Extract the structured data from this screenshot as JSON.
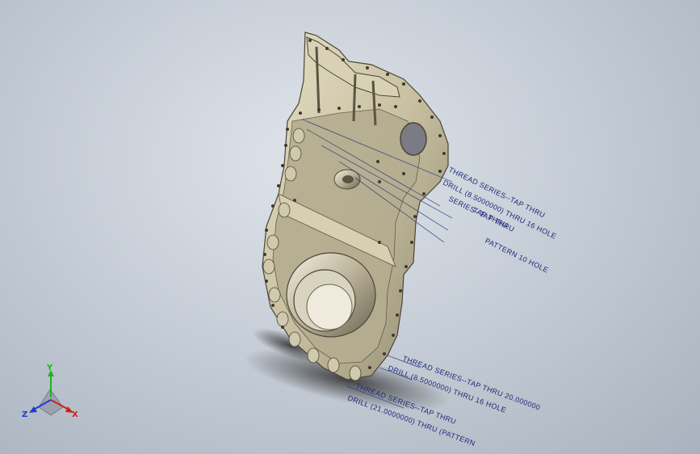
{
  "colors": {
    "background": "#c7ced7",
    "part_body": "#c8c0a0",
    "part_shadow": "#6e6a58",
    "annotation": "#1e2a7a",
    "axis_x": "#d21e1e",
    "axis_y": "#1eb41e",
    "axis_z": "#1e3cd2"
  },
  "annotations": {
    "upper": [
      "THREAD SERIES--TAP THRU",
      "DRILL (8.5000000) THRU 16 HOLE",
      "SERIES--TAP THRU",
      "TAP THRU",
      "PATTERN 10 HOLE"
    ],
    "lower": [
      "THREAD SERIES--TAP THRU 20.000000",
      "DRILL (8.5000000) THRU 16 HOLE",
      "THREAD SERIES--TAP THRU",
      "DRILL (21.0000000) THRU (PATTERN"
    ]
  },
  "triad": {
    "x": "X",
    "y": "Y",
    "z": "Z"
  }
}
